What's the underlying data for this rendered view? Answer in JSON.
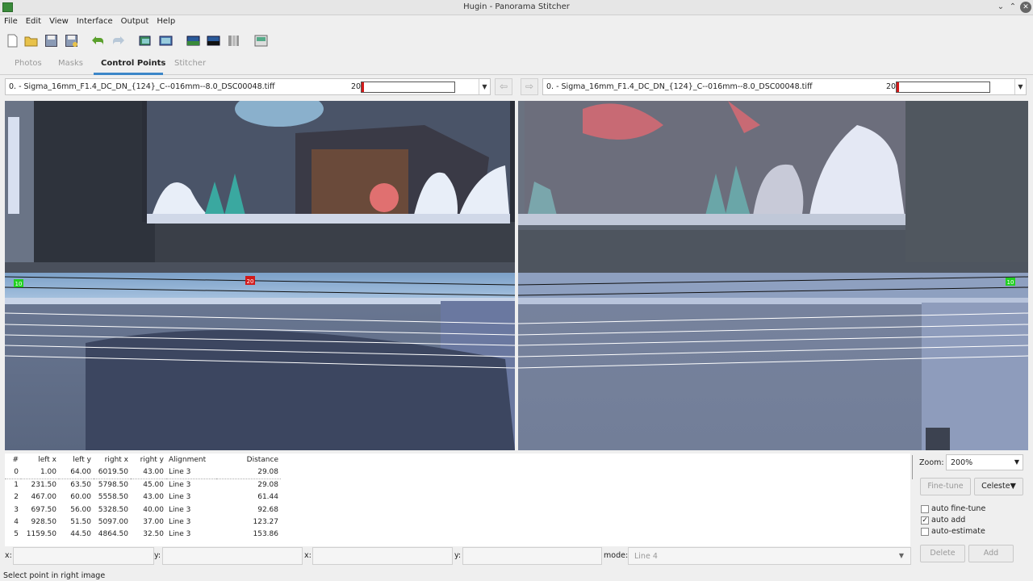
{
  "window": {
    "title": "Hugin - Panorama Stitcher"
  },
  "menu": [
    "File",
    "Edit",
    "View",
    "Interface",
    "Output",
    "Help"
  ],
  "toolbar_icons": [
    "new-project-icon",
    "open-project-icon",
    "save-icon",
    "save-as-icon",
    "undo-icon",
    "redo-icon",
    "add-images-icon",
    "add-time-series-icon",
    "preview-icon",
    "fast-preview-icon",
    "layout-preview-icon",
    "stitch-icon"
  ],
  "tabs": [
    {
      "label": "Photos",
      "active": false
    },
    {
      "label": "Masks",
      "active": false
    },
    {
      "label": "Control Points",
      "active": true
    },
    {
      "label": "Stitcher",
      "active": false
    }
  ],
  "left_image": {
    "name": "0. - Sigma_16mm_F1.4_DC_DN_{124}_C--016mm--8.0_DSC00048.tiff",
    "cp_count": "20",
    "fill": 0.03
  },
  "right_image": {
    "name": "0. - Sigma_16mm_F1.4_DC_DN_{124}_C--016mm--8.0_DSC00048.tiff",
    "cp_count": "20",
    "fill": 0.03
  },
  "markers": {
    "left_green": "10",
    "left_red": "20",
    "right_green": "10"
  },
  "table": {
    "headers": [
      "#",
      "left x",
      "left y",
      "right x",
      "right y",
      "Alignment",
      "Distance"
    ],
    "rows": [
      [
        "0",
        "1.00",
        "64.00",
        "6019.50",
        "43.00",
        "Line 3",
        "29.08"
      ],
      [
        "1",
        "231.50",
        "63.50",
        "5798.50",
        "45.00",
        "Line 3",
        "29.08"
      ],
      [
        "2",
        "467.00",
        "60.00",
        "5558.50",
        "43.00",
        "Line 3",
        "61.44"
      ],
      [
        "3",
        "697.50",
        "56.00",
        "5328.50",
        "40.00",
        "Line 3",
        "92.68"
      ],
      [
        "4",
        "928.50",
        "51.50",
        "5097.00",
        "37.00",
        "Line 3",
        "123.27"
      ],
      [
        "5",
        "1159.50",
        "44.50",
        "4864.50",
        "32.50",
        "Line 3",
        "153.86"
      ]
    ]
  },
  "zoom": {
    "label": "Zoom:",
    "value": "200%"
  },
  "buttons": {
    "fine_tune": "Fine-tune",
    "celeste": "Celeste▼",
    "delete": "Delete",
    "add": "Add"
  },
  "options": [
    {
      "label": "auto fine-tune",
      "checked": false
    },
    {
      "label": "auto add",
      "checked": true
    },
    {
      "label": "auto-estimate",
      "checked": false
    }
  ],
  "coords": {
    "x_label": "x:",
    "y_label": "y:"
  },
  "mode": {
    "label": "mode:",
    "value": "Line 4"
  },
  "status": "Select point in right image",
  "colors": {
    "accent": "#3c86c8",
    "cp_green": "#22d022",
    "cp_red": "#d21a1a"
  }
}
